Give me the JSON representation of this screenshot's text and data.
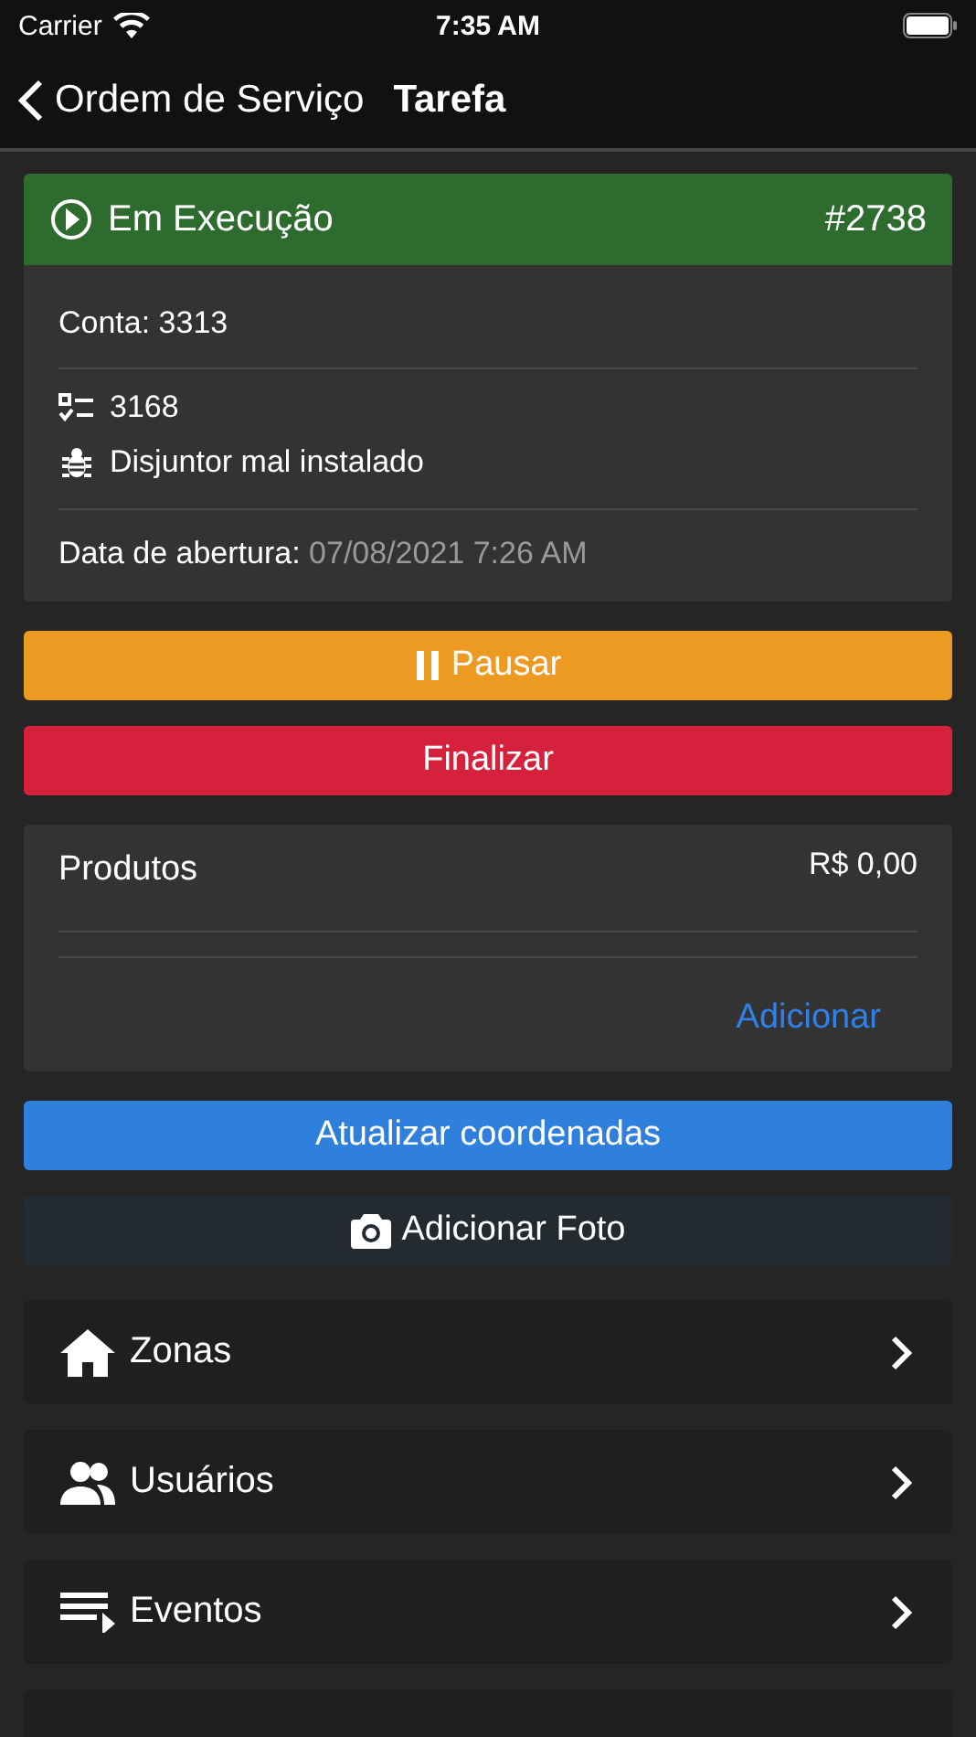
{
  "status_bar": {
    "carrier": "Carrier",
    "time": "7:35 AM"
  },
  "nav": {
    "back_label": "Ordem de Serviço",
    "title": "Tarefa"
  },
  "task": {
    "status": "Em Execução",
    "number": "#2738",
    "account": "Conta: 3313",
    "details": [
      {
        "kind": "checklist",
        "text": "3168"
      },
      {
        "kind": "bug",
        "text": "Disjuntor mal instalado"
      }
    ],
    "opened_label": "Data de abertura:",
    "opened_value": "07/08/2021 7:26 AM"
  },
  "status_actions": [
    {
      "kind": "pause",
      "label": "Pausar"
    },
    {
      "kind": "finish",
      "label": "Finalizar"
    }
  ],
  "products": {
    "title": "Produtos",
    "total": "R$ 0,00",
    "add_label": "Adicionar"
  },
  "actions": [
    {
      "kind": "coordinates",
      "label": "Atualizar coordenadas"
    },
    {
      "kind": "photo",
      "label": "Adicionar Foto"
    }
  ],
  "menu": [
    {
      "kind": "home",
      "label": "Zonas"
    },
    {
      "kind": "users",
      "label": "Usuários"
    },
    {
      "kind": "events",
      "label": "Eventos"
    },
    {
      "kind": "partial"
    }
  ]
}
